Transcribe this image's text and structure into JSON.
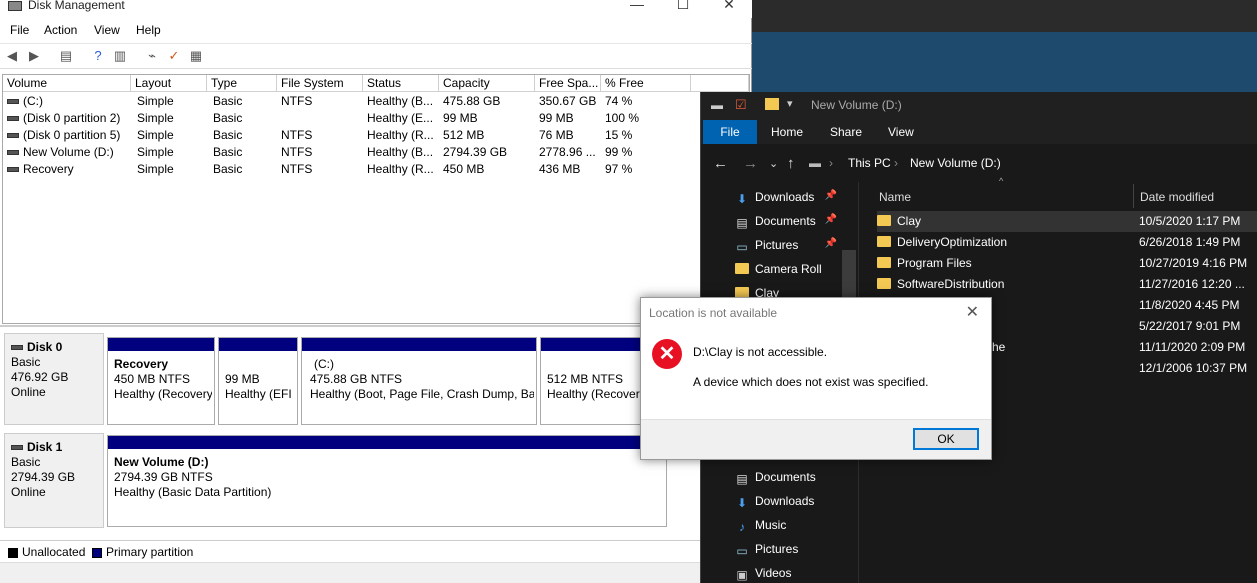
{
  "disk_management": {
    "title": "Disk Management",
    "menu": [
      "File",
      "Action",
      "View",
      "Help"
    ],
    "caption_icons": [
      "minimize-icon",
      "maximize-icon",
      "close-icon"
    ],
    "columns": [
      "Volume",
      "Layout",
      "Type",
      "File System",
      "Status",
      "Capacity",
      "Free Spa...",
      "% Free"
    ],
    "volumes": [
      {
        "volume": "(C:)",
        "layout": "Simple",
        "type": "Basic",
        "fs": "NTFS",
        "status": "Healthy (B...",
        "capacity": "475.88 GB",
        "free": "350.67 GB",
        "pct": "74 %"
      },
      {
        "volume": "(Disk 0 partition 2)",
        "layout": "Simple",
        "type": "Basic",
        "fs": "",
        "status": "Healthy (E...",
        "capacity": "99 MB",
        "free": "99 MB",
        "pct": "100 %"
      },
      {
        "volume": "(Disk 0 partition 5)",
        "layout": "Simple",
        "type": "Basic",
        "fs": "NTFS",
        "status": "Healthy (R...",
        "capacity": "512 MB",
        "free": "76 MB",
        "pct": "15 %"
      },
      {
        "volume": "New Volume (D:)",
        "layout": "Simple",
        "type": "Basic",
        "fs": "NTFS",
        "status": "Healthy (B...",
        "capacity": "2794.39 GB",
        "free": "2778.96 ...",
        "pct": "99 %"
      },
      {
        "volume": "Recovery",
        "layout": "Simple",
        "type": "Basic",
        "fs": "NTFS",
        "status": "Healthy (R...",
        "capacity": "450 MB",
        "free": "436 MB",
        "pct": "97 %"
      }
    ],
    "disks": [
      {
        "name": "Disk 0",
        "kind": "Basic",
        "size": "476.92 GB",
        "state": "Online",
        "partitions": [
          {
            "name": "Recovery",
            "size": "450 MB NTFS",
            "health": "Healthy (Recovery"
          },
          {
            "name": "",
            "size": "99 MB",
            "health": "Healthy (EFI S"
          },
          {
            "name": "(C:)",
            "size": "475.88 GB NTFS",
            "health": "Healthy (Boot, Page File, Crash Dump, Bas"
          },
          {
            "name": "",
            "size": "512 MB NTFS",
            "health": "Healthy (Recovery"
          }
        ]
      },
      {
        "name": "Disk 1",
        "kind": "Basic",
        "size": "2794.39 GB",
        "state": "Online",
        "partitions": [
          {
            "name": "New Volume  (D:)",
            "size": "2794.39 GB NTFS",
            "health": "Healthy (Basic Data Partition)"
          }
        ]
      }
    ],
    "legend": [
      {
        "label": "Unallocated",
        "color": "#000000"
      },
      {
        "label": "Primary partition",
        "color": "#010180"
      }
    ]
  },
  "explorer": {
    "title": "New Volume (D:)",
    "ribbon_tabs": [
      "File",
      "Home",
      "Share",
      "View"
    ],
    "breadcrumb": [
      "This PC",
      "New Volume (D:)"
    ],
    "nav_top": [
      {
        "label": "Downloads",
        "icon": "download-icon",
        "pinned": true
      },
      {
        "label": "Documents",
        "icon": "document-icon",
        "pinned": true
      },
      {
        "label": "Pictures",
        "icon": "pictures-icon",
        "pinned": true
      },
      {
        "label": "Camera Roll",
        "icon": "folder-icon",
        "pinned": false
      },
      {
        "label": "Clay",
        "icon": "folder-icon",
        "pinned": false
      }
    ],
    "nav_bottom": [
      {
        "label": "Documents",
        "icon": "document-icon"
      },
      {
        "label": "Downloads",
        "icon": "download-icon"
      },
      {
        "label": "Music",
        "icon": "music-icon"
      },
      {
        "label": "Pictures",
        "icon": "pictures-icon"
      },
      {
        "label": "Videos",
        "icon": "videos-icon"
      }
    ],
    "columns": [
      "Name",
      "Date modified"
    ],
    "files": [
      {
        "name": "Clay",
        "date": "10/5/2020 1:17 PM"
      },
      {
        "name": "DeliveryOptimization",
        "date": "6/26/2018 1:49 PM"
      },
      {
        "name": "Program Files",
        "date": "10/27/2019 4:16 PM"
      },
      {
        "name": "SoftwareDistribution",
        "date": "11/27/2016 12:20 ..."
      },
      {
        "name": "",
        "date": "11/8/2020 4:45 PM"
      },
      {
        "name": "",
        "date": "5/22/2017 9:01 PM"
      },
      {
        "name": "he",
        "date": "11/11/2020 2:09 PM"
      },
      {
        "name": "",
        "date": "12/1/2006 10:37 PM"
      }
    ]
  },
  "dialog": {
    "title": "Location is not available",
    "message": "D:\\Clay is not accessible.",
    "detail": "A device which does not exist was specified.",
    "ok_label": "OK"
  }
}
